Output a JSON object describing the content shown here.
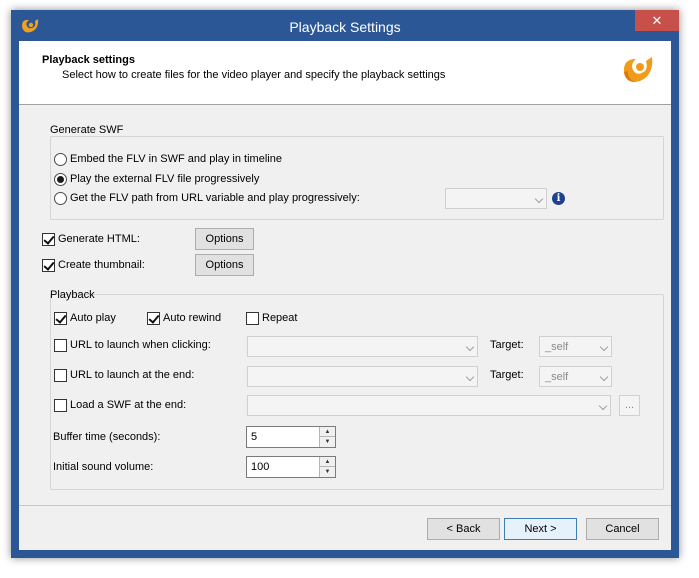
{
  "window": {
    "title": "Playback Settings",
    "close_glyph": "✕",
    "close_color": "#c7504a",
    "titlebar_color": "#2b5797"
  },
  "header": {
    "title": "Playback settings",
    "subtitle": "Select how to create files for the video player and specify the playback settings",
    "logo_icon": "app-logo-icon"
  },
  "generate_swf": {
    "label": "Generate SWF",
    "options": [
      {
        "label": "Embed the FLV in SWF and play in timeline",
        "selected": false
      },
      {
        "label": "Play the external FLV file progressively",
        "selected": true
      },
      {
        "label": "Get the FLV path from URL variable and play progressively:",
        "selected": false
      }
    ],
    "url_variable_value": "",
    "info_glyph": "i"
  },
  "generate_html": {
    "label": "Generate HTML:",
    "checked": true,
    "options_label": "Options"
  },
  "create_thumbnail": {
    "label": "Create thumbnail:",
    "checked": true,
    "options_label": "Options"
  },
  "playback": {
    "label": "Playback",
    "auto_play": {
      "label": "Auto play",
      "checked": true
    },
    "auto_rewind": {
      "label": "Auto rewind",
      "checked": true
    },
    "repeat": {
      "label": "Repeat",
      "checked": false
    },
    "url_click": {
      "label": "URL to launch when clicking:",
      "checked": false,
      "value": "",
      "target_label": "Target:",
      "target_value": "_self"
    },
    "url_end": {
      "label": "URL to launch at the end:",
      "checked": false,
      "value": "",
      "target_label": "Target:",
      "target_value": "_self"
    },
    "load_swf": {
      "label": "Load a SWF at the end:",
      "checked": false,
      "value": "",
      "browse_label": "..."
    },
    "buffer_time": {
      "label": "Buffer time (seconds):",
      "value": "5"
    },
    "sound_volume": {
      "label": "Initial sound volume:",
      "value": "100"
    }
  },
  "footer": {
    "back_label": "< Back",
    "next_label": "Next >",
    "cancel_label": "Cancel"
  }
}
